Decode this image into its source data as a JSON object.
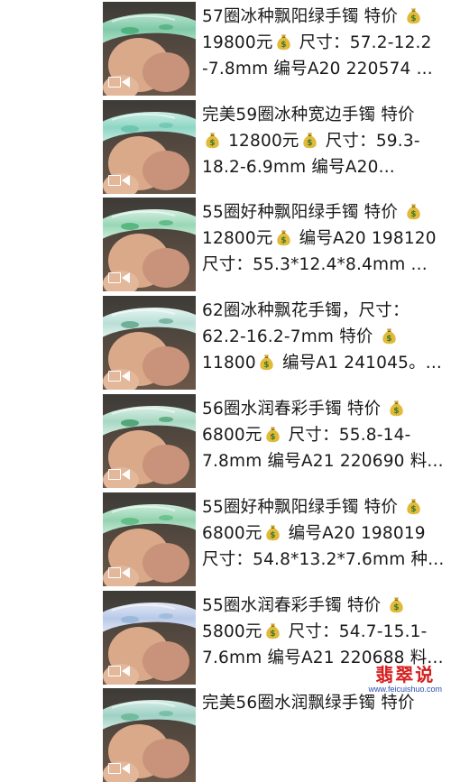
{
  "listings": [
    {
      "parts": [
        "57圈冰种飘阳绿手镯 特价",
        "19800元",
        "尺寸：57.2-12.2-7.8mm 编号A20 220574 ..."
      ],
      "thumb_colors": [
        "#7fc9a8",
        "#b9e3cf",
        "#3da56e"
      ],
      "icon": "video-icon"
    },
    {
      "parts": [
        "完美59圈冰种宽边手镯 特价",
        "12800元",
        "尺寸：59.3-18.2-6.9mm 编号A20..."
      ],
      "thumb_colors": [
        "#8fd6c4",
        "#c8ece3",
        "#5dbfa8"
      ],
      "icon": "video-icon"
    },
    {
      "parts": [
        "55圈好种飘阳绿手镯 特价",
        "12800元",
        "编号A20 198120 尺寸：55.3*12.4*8.4mm ..."
      ],
      "thumb_colors": [
        "#9ad7b6",
        "#d5efe2",
        "#3aa866"
      ],
      "icon": "video-icon"
    },
    {
      "parts": [
        "62圈冰种飘花手镯，尺寸：62.2-16.2-7mm 特价",
        "11800",
        "编号A1 241045。..."
      ],
      "thumb_colors": [
        "#b9dfd6",
        "#e6f5f1",
        "#4f9a7c"
      ],
      "icon": "video-icon"
    },
    {
      "parts": [
        "56圈水润春彩手镯 特价",
        "6800元",
        "尺寸：55.8-14-7.8mm 编号A21 220690 料..."
      ],
      "thumb_colors": [
        "#a7d8c3",
        "#dbefe7",
        "#2f8f5a"
      ],
      "icon": "video-icon"
    },
    {
      "parts": [
        "55圈好种飘阳绿手镯 特价",
        "6800元",
        "编号A20 198019 尺寸：54.8*13.2*7.6mm 种..."
      ],
      "thumb_colors": [
        "#95d2b0",
        "#cdeedc",
        "#4bb574"
      ],
      "icon": "video-icon"
    },
    {
      "parts": [
        "55圈水润春彩手镯 特价",
        "5800元",
        "尺寸：54.7-15.1-7.6mm 编号A21 220688 料..."
      ],
      "thumb_colors": [
        "#b8c9e8",
        "#e2e9f6",
        "#8fb0d6"
      ],
      "icon": "video-icon"
    },
    {
      "parts": [
        "完美56圈水润飘绿手镯 特价",
        "",
        ""
      ],
      "thumb_colors": [
        "#9fd1c4",
        "#d6ede7",
        "#5cb08f"
      ],
      "icon": "video-icon"
    }
  ],
  "money_bag_icon": "money-bag-icon",
  "watermark": {
    "title": "翡翠说",
    "url": "www.feicuishuo.com"
  }
}
